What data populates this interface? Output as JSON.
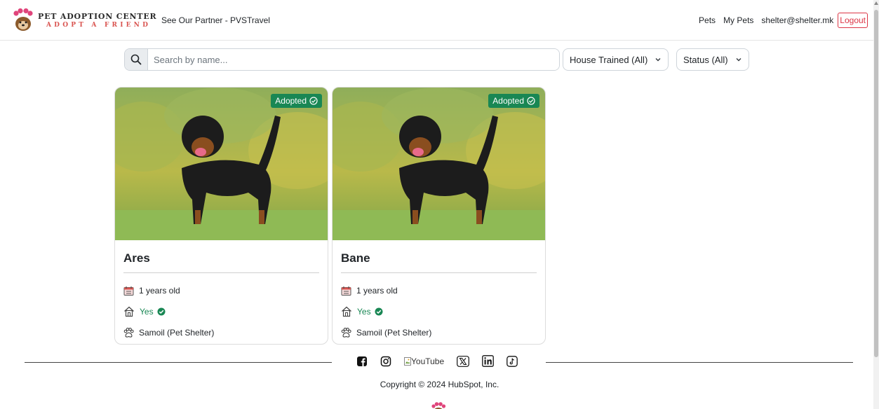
{
  "brand": {
    "title": "PET ADOPTION CENTER",
    "subtitle": "ADOPT A FRIEND"
  },
  "nav": {
    "partner": "See Our Partner - PVSTravel",
    "pets": "Pets",
    "my_pets": "My Pets",
    "user": "shelter@shelter.mk",
    "logout": "Logout"
  },
  "search": {
    "placeholder": "Search by name..."
  },
  "filters": {
    "house_trained": "House Trained (All)",
    "status": "Status (All)"
  },
  "cards": [
    {
      "name": "Ares",
      "badge": "Adopted",
      "age": "1 years old",
      "house_trained": "Yes",
      "shelter": "Samoil (Pet Shelter)"
    },
    {
      "name": "Bane",
      "badge": "Adopted",
      "age": "1 years old",
      "house_trained": "Yes",
      "shelter": "Samoil (Pet Shelter)"
    }
  ],
  "footer": {
    "youtube_alt": "YouTube",
    "copyright": "Copyright © 2024 HubSpot, Inc."
  },
  "colors": {
    "adopted": "#198754",
    "logout": "#dc3545",
    "brand_sub": "#d9534f"
  }
}
